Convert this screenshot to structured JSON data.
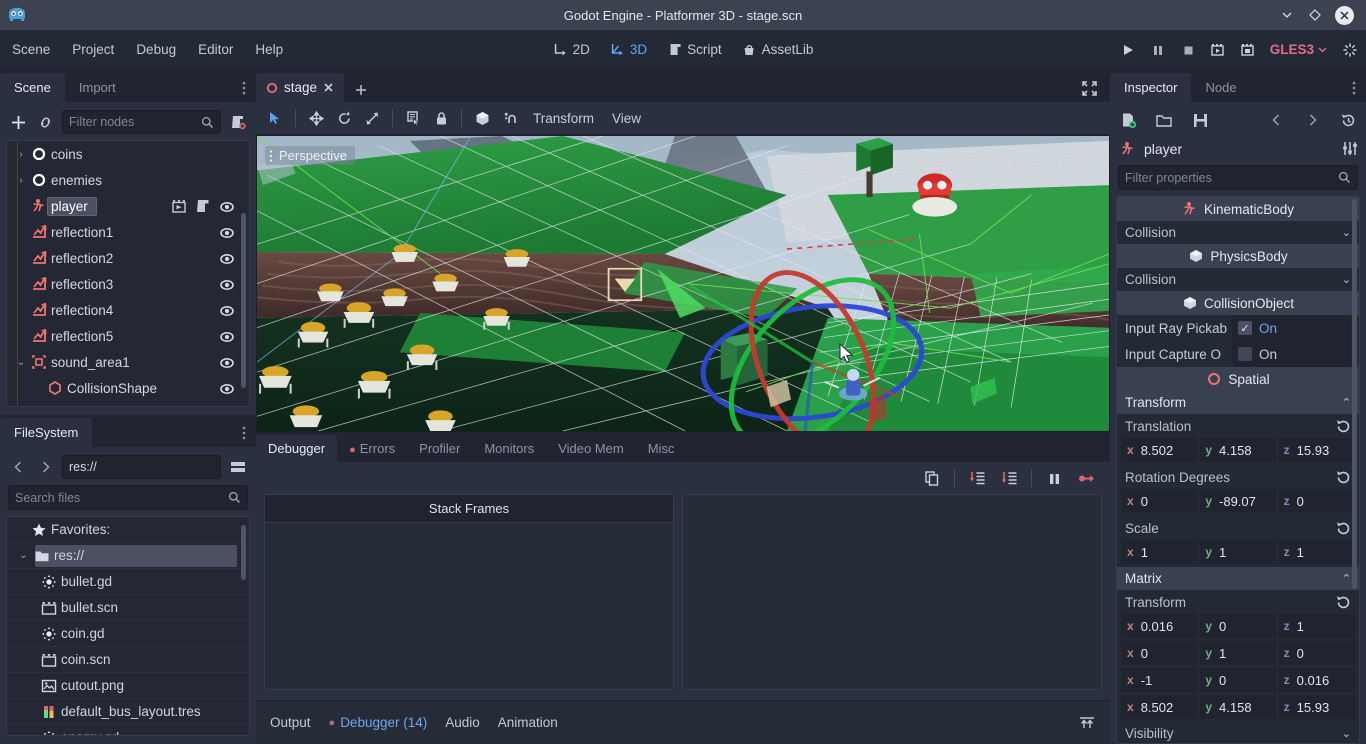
{
  "window": {
    "title": "Godot Engine - Platformer 3D - stage.scn",
    "logo_icon": "godot-logo-icon",
    "buttons": [
      {
        "name": "minimize-button",
        "icon": "chevron-down-icon",
        "glyph": "⌄"
      },
      {
        "name": "maximize-button",
        "icon": "diamond-icon",
        "glyph": "◇"
      },
      {
        "name": "close-button",
        "icon": "close-icon",
        "glyph": "✕"
      }
    ]
  },
  "menubar": {
    "items": [
      "Scene",
      "Project",
      "Debug",
      "Editor",
      "Help"
    ],
    "mode_tabs": [
      {
        "label": "2D",
        "icon": "axis-2d-icon",
        "active": false
      },
      {
        "label": "3D",
        "icon": "axis-3d-icon",
        "active": true
      },
      {
        "label": "Script",
        "icon": "script-icon",
        "active": false
      },
      {
        "label": "AssetLib",
        "icon": "assetlib-icon",
        "active": false
      }
    ],
    "playback": [
      {
        "name": "play-button",
        "icon": "play-icon"
      },
      {
        "name": "pause-button",
        "icon": "pause-icon"
      },
      {
        "name": "stop-button",
        "icon": "stop-icon"
      },
      {
        "name": "play-scene-button",
        "icon": "play-scene-icon"
      },
      {
        "name": "play-custom-scene-button",
        "icon": "play-custom-scene-icon"
      }
    ],
    "renderer": {
      "label": "GLES3",
      "color": "#e06c8b",
      "chevron": "⌄"
    },
    "settings_icon": "settings-spinner-icon"
  },
  "scene_dock": {
    "tabs": [
      {
        "label": "Scene",
        "active": true
      },
      {
        "label": "Import",
        "active": false
      }
    ],
    "menu_icon": "vertical-dots-icon",
    "toolbar": [
      {
        "name": "add-node-button",
        "icon": "plus-icon"
      },
      {
        "name": "instance-scene-button",
        "icon": "link-icon"
      }
    ],
    "filter": {
      "placeholder": "Filter nodes",
      "value": "",
      "search_icon": "search-icon"
    },
    "script_button_icon": "create-script-icon",
    "nodes": [
      {
        "label": "coins",
        "icon": "node-spatial-icon",
        "indent": 1,
        "expand": "›",
        "selected": false,
        "visibility": false,
        "extra": []
      },
      {
        "label": "enemies",
        "icon": "node-spatial-icon",
        "indent": 1,
        "expand": "›",
        "selected": false,
        "visibility": false,
        "extra": []
      },
      {
        "label": "player",
        "icon": "kinematic-body-icon",
        "indent": 1,
        "expand": "",
        "selected": true,
        "visibility": true,
        "extra": [
          "open-scene-icon",
          "script-icon"
        ]
      },
      {
        "label": "reflection1",
        "icon": "reflection-probe-icon",
        "indent": 1,
        "expand": "",
        "selected": false,
        "visibility": true,
        "extra": []
      },
      {
        "label": "reflection2",
        "icon": "reflection-probe-icon",
        "indent": 1,
        "expand": "",
        "selected": false,
        "visibility": true,
        "extra": []
      },
      {
        "label": "reflection3",
        "icon": "reflection-probe-icon",
        "indent": 1,
        "expand": "",
        "selected": false,
        "visibility": true,
        "extra": []
      },
      {
        "label": "reflection4",
        "icon": "reflection-probe-icon",
        "indent": 1,
        "expand": "",
        "selected": false,
        "visibility": true,
        "extra": []
      },
      {
        "label": "reflection5",
        "icon": "reflection-probe-icon",
        "indent": 1,
        "expand": "",
        "selected": false,
        "visibility": true,
        "extra": []
      },
      {
        "label": "sound_area1",
        "icon": "area-icon",
        "indent": 1,
        "expand": "⌄",
        "selected": false,
        "visibility": true,
        "extra": []
      },
      {
        "label": "CollisionShape",
        "icon": "collision-shape-icon",
        "indent": 2,
        "expand": "",
        "selected": false,
        "visibility": true,
        "extra": []
      }
    ]
  },
  "filesystem_dock": {
    "tab": "FileSystem",
    "menu_icon": "vertical-dots-icon",
    "nav": {
      "back_icon": "chevron-left-icon",
      "forward_icon": "chevron-right-icon",
      "layout_icon": "split-layout-icon"
    },
    "path": "res://",
    "search": {
      "placeholder": "Search files",
      "value": "",
      "search_icon": "search-icon"
    },
    "entries": [
      {
        "label": "Favorites:",
        "icon": "star-icon",
        "indent": 1,
        "expand": "",
        "selected": false
      },
      {
        "label": "res://",
        "icon": "folder-icon",
        "indent": 0,
        "expand": "⌄",
        "selected": true
      },
      {
        "label": "bullet.gd",
        "icon": "gdscript-icon",
        "indent": 2,
        "expand": "",
        "selected": false
      },
      {
        "label": "bullet.scn",
        "icon": "scene-file-icon",
        "indent": 2,
        "expand": "",
        "selected": false
      },
      {
        "label": "coin.gd",
        "icon": "gdscript-icon",
        "indent": 2,
        "expand": "",
        "selected": false
      },
      {
        "label": "coin.scn",
        "icon": "scene-file-icon",
        "indent": 2,
        "expand": "",
        "selected": false
      },
      {
        "label": "cutout.png",
        "icon": "image-file-icon",
        "indent": 2,
        "expand": "",
        "selected": false
      },
      {
        "label": "default_bus_layout.tres",
        "icon": "audio-bus-icon",
        "indent": 2,
        "expand": "",
        "selected": false
      },
      {
        "label": "enemy.gd",
        "icon": "gdscript-icon",
        "indent": 2,
        "expand": "",
        "selected": false
      }
    ]
  },
  "editor": {
    "scene_tab": {
      "label": "stage",
      "icon": "unsaved-scene-icon",
      "close_icon": "close-icon"
    },
    "add_tab_icon": "plus-icon",
    "maximize_icon": "maximize-icon",
    "viewport_toolbar": {
      "tools": [
        {
          "name": "select-mode-button",
          "icon": "cursor-arrow-icon",
          "active": true
        },
        {
          "name": "move-mode-button",
          "icon": "move-icon",
          "active": false
        },
        {
          "name": "rotate-mode-button",
          "icon": "rotate-icon",
          "active": false
        },
        {
          "name": "scale-mode-button",
          "icon": "scale-icon",
          "active": false
        },
        {
          "name": "list-select-button",
          "icon": "list-select-icon",
          "active": false
        },
        {
          "name": "lock-button",
          "icon": "lock-icon",
          "active": false
        },
        {
          "name": "local-space-button",
          "icon": "cube-icon",
          "active": false
        },
        {
          "name": "snap-mode-button",
          "icon": "snap-magnet-icon",
          "active": false
        }
      ],
      "menus": [
        "Transform",
        "View"
      ]
    },
    "viewport": {
      "perspective_label": "Perspective",
      "dots_icon": "vertical-dots-icon",
      "cursor_icon": "mouse-cursor-icon"
    }
  },
  "debugger": {
    "tabs": [
      {
        "label": "Debugger",
        "active": true,
        "error_dot": false
      },
      {
        "label": "Errors",
        "active": false,
        "error_dot": true
      },
      {
        "label": "Profiler",
        "active": false,
        "error_dot": false
      },
      {
        "label": "Monitors",
        "active": false,
        "error_dot": false
      },
      {
        "label": "Video Mem",
        "active": false,
        "error_dot": false
      },
      {
        "label": "Misc",
        "active": false,
        "error_dot": false
      }
    ],
    "toolbar": [
      {
        "name": "copy-error-button",
        "icon": "copy-icon"
      },
      {
        "name": "step-into-button",
        "icon": "step-into-icon"
      },
      {
        "name": "step-over-button",
        "icon": "step-over-icon"
      },
      {
        "name": "break-button",
        "icon": "pause-icon"
      },
      {
        "name": "continue-button",
        "icon": "continue-icon"
      }
    ],
    "stack_frames_header": "Stack Frames",
    "stack_frames": [],
    "inspect_values": []
  },
  "statusbar": {
    "tabs": [
      {
        "label": "Output",
        "active": false,
        "dot": false
      },
      {
        "label": "Debugger (14)",
        "active": true,
        "dot": true
      },
      {
        "label": "Audio",
        "active": false,
        "dot": false
      },
      {
        "label": "Animation",
        "active": false,
        "dot": false
      }
    ],
    "expand_icon": "expand-bottom-panel-icon"
  },
  "inspector": {
    "tabs": [
      {
        "label": "Inspector",
        "active": true
      },
      {
        "label": "Node",
        "active": false
      }
    ],
    "menu_icon": "vertical-dots-icon",
    "toolbar": [
      {
        "name": "new-resource-button",
        "icon": "new-resource-icon"
      },
      {
        "name": "load-resource-button",
        "icon": "folder-icon"
      },
      {
        "name": "save-resource-button",
        "icon": "save-icon"
      },
      {
        "name": "history-back-button",
        "icon": "chevron-left-icon"
      },
      {
        "name": "history-forward-button",
        "icon": "chevron-right-icon"
      },
      {
        "name": "history-menu-button",
        "icon": "history-icon"
      }
    ],
    "node": {
      "name": "player",
      "icon": "kinematic-body-icon",
      "tools_icon": "object-tools-icon"
    },
    "filter": {
      "placeholder": "Filter properties",
      "value": "",
      "search_icon": "search-icon"
    },
    "sections": [
      {
        "type": "category",
        "label": "KinematicBody",
        "icon": "kinematic-body-icon"
      },
      {
        "type": "property_group",
        "label": "Collision",
        "chevron": "⌄"
      },
      {
        "type": "category",
        "label": "PhysicsBody",
        "icon": "cube-icon"
      },
      {
        "type": "property_group",
        "label": "Collision",
        "chevron": "⌄"
      },
      {
        "type": "category",
        "label": "CollisionObject",
        "icon": "cube-icon"
      },
      {
        "type": "bool",
        "label": "Input Ray Pickab",
        "value": "On",
        "checked": true
      },
      {
        "type": "bool",
        "label": "Input Capture O",
        "value": "On",
        "checked": false
      },
      {
        "type": "category",
        "label": "Spatial",
        "icon": "spatial-icon"
      },
      {
        "type": "property_group_open",
        "label": "Transform",
        "chevron": "⌃"
      },
      {
        "type": "vector_label",
        "label": "Translation",
        "reset_icon": "revert-icon"
      },
      {
        "type": "vector",
        "x": "8.502",
        "y": "4.158",
        "z": "15.93"
      },
      {
        "type": "vector_label",
        "label": "Rotation Degrees",
        "reset_icon": "revert-icon"
      },
      {
        "type": "vector",
        "x": "0",
        "y": "-89.07",
        "z": "0"
      },
      {
        "type": "vector_label",
        "label": "Scale",
        "reset_icon": "revert-icon"
      },
      {
        "type": "vector",
        "x": "1",
        "y": "1",
        "z": "1"
      },
      {
        "type": "property_group_open",
        "label": "Matrix",
        "chevron": "⌃"
      },
      {
        "type": "vector_label",
        "label": "Transform",
        "reset_icon": "revert-icon"
      },
      {
        "type": "vector",
        "x": "0.016",
        "y": "0",
        "z": "1"
      },
      {
        "type": "vector",
        "x": "0",
        "y": "1",
        "z": "0"
      },
      {
        "type": "vector",
        "x": "-1",
        "y": "0",
        "z": "0.016"
      },
      {
        "type": "vector",
        "x": "8.502",
        "y": "4.158",
        "z": "15.93"
      },
      {
        "type": "property_group",
        "label": "Visibility",
        "chevron": "⌄"
      }
    ]
  },
  "colors": {
    "accent": "#57a8f5",
    "panel": "#2a3040",
    "background": "#202531",
    "titlebar": "#3b4250",
    "error_red": "#e0636f",
    "renderer_pink": "#e06c8b",
    "node_red": "#f0736f"
  }
}
